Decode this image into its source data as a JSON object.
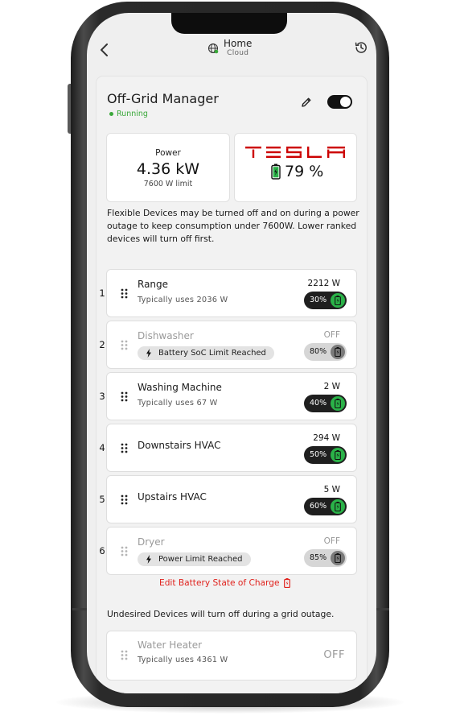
{
  "header": {
    "title": "Home",
    "subtitle": "Cloud"
  },
  "manager": {
    "title": "Off-Grid Manager",
    "status": "Running",
    "enabled": true,
    "power_label": "Power",
    "power_value": "4.36 kW",
    "power_limit": "7600 W limit",
    "brand": "TESLA",
    "battery_percent": "79 %",
    "battery_level": 0.79,
    "explanation": "Flexible Devices may be turned off and on during a power outage to keep consumption under 7600W. Lower ranked devices will turn off first."
  },
  "flexible_devices": [
    {
      "rank": "1",
      "name": "Range",
      "detail": "Typically uses 2036 W",
      "power": "2212 W",
      "soc_limit": "30%",
      "on": true,
      "limited": false
    },
    {
      "rank": "2",
      "name": "Dishwasher",
      "detail": "Battery SoC Limit Reached",
      "power": "OFF",
      "soc_limit": "80%",
      "on": false,
      "limited": true
    },
    {
      "rank": "3",
      "name": "Washing Machine",
      "detail": "Typically uses 67 W",
      "power": "2 W",
      "soc_limit": "40%",
      "on": true,
      "limited": false
    },
    {
      "rank": "4",
      "name": "Downstairs HVAC",
      "detail": "",
      "power": "294 W",
      "soc_limit": "50%",
      "on": true,
      "limited": false
    },
    {
      "rank": "5",
      "name": "Upstairs HVAC",
      "detail": "",
      "power": "5 W",
      "soc_limit": "60%",
      "on": true,
      "limited": false
    },
    {
      "rank": "6",
      "name": "Dryer",
      "detail": "Power Limit Reached",
      "power": "OFF",
      "soc_limit": "85%",
      "on": false,
      "limited": true
    }
  ],
  "edit_link": "Edit Battery State of Charge",
  "undesired_text": "Undesired Devices will turn off during a grid outage.",
  "undesired_devices": [
    {
      "name": "Water Heater",
      "detail": "Typically uses 4361 W",
      "power": "OFF"
    }
  ],
  "colors": {
    "accent_green": "#2ab248",
    "running_green": "#3aa83a",
    "link_red": "#e0221d",
    "tesla_red": "#cc0000"
  },
  "icons": [
    "back-arrow-icon",
    "globe-icon",
    "history-icon",
    "pencil-icon",
    "battery-icon",
    "drag-handle-icon",
    "lightning-bolt-icon"
  ]
}
